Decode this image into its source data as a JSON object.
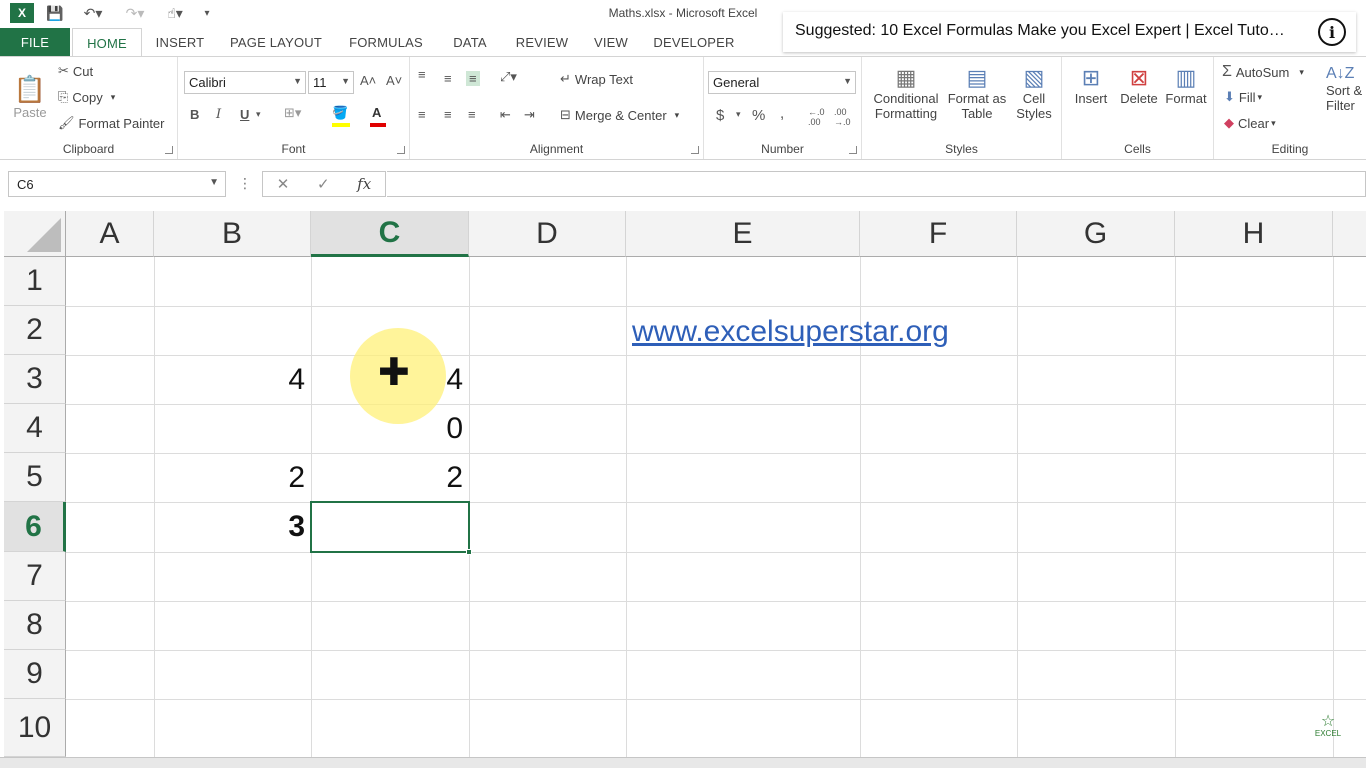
{
  "window": {
    "title": "Maths.xlsx - Microsoft Excel"
  },
  "quick_access": {
    "save_icon": "save-icon",
    "undo_icon": "undo-icon",
    "redo_icon": "redo-icon",
    "customize_icon": "customize-icon"
  },
  "tabs": [
    "FILE",
    "HOME",
    "INSERT",
    "PAGE LAYOUT",
    "FORMULAS",
    "DATA",
    "REVIEW",
    "VIEW",
    "DEVELOPER"
  ],
  "suggestion": {
    "text": "Suggested: 10 Excel Formulas Make you Excel Expert | Excel Tuto…",
    "info_glyph": "i"
  },
  "ribbon": {
    "clipboard": {
      "label": "Clipboard",
      "paste": "Paste",
      "cut": "Cut",
      "copy": "Copy",
      "format_painter": "Format Painter"
    },
    "font": {
      "label": "Font",
      "font_name": "Calibri",
      "font_size": "11",
      "bold": "B",
      "italic": "I",
      "underline": "U"
    },
    "alignment": {
      "label": "Alignment",
      "wrap_text": "Wrap Text",
      "merge_center": "Merge & Center"
    },
    "number": {
      "label": "Number",
      "format": "General",
      "currency": "$",
      "percent": "%",
      "comma": ","
    },
    "styles": {
      "label": "Styles",
      "conditional_1": "Conditional",
      "conditional_2": "Formatting",
      "format_table_1": "Format as",
      "format_table_2": "Table",
      "cell_styles_1": "Cell",
      "cell_styles_2": "Styles"
    },
    "cells": {
      "label": "Cells",
      "insert": "Insert",
      "delete": "Delete",
      "format": "Format"
    },
    "editing": {
      "label": "Editing",
      "autosum": "AutoSum",
      "fill": "Fill",
      "clear": "Clear",
      "sort_1": "Sort &",
      "sort_2": "Filter"
    }
  },
  "formula_bar": {
    "name_box": "C6",
    "cancel": "✕",
    "enter": "✓",
    "fx": "fx",
    "formula": ""
  },
  "sheet": {
    "columns": [
      "A",
      "B",
      "C",
      "D",
      "E",
      "F",
      "G",
      "H"
    ],
    "rows": [
      "1",
      "2",
      "3",
      "4",
      "5",
      "6",
      "7",
      "8",
      "9",
      "10"
    ],
    "selected_column": "C",
    "selected_row": "6",
    "cells": {
      "B3": "4",
      "C3": "4",
      "C4": "0",
      "B5": "2",
      "C5": "2",
      "B6": "3"
    },
    "link_E2": "www.excelsuperstar.org"
  },
  "watermark": {
    "text": "EXCEL"
  }
}
